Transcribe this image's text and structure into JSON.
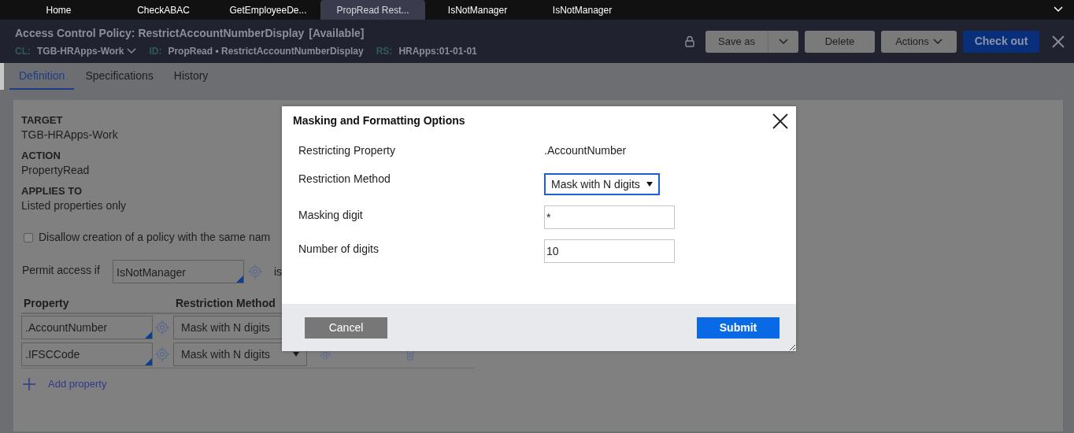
{
  "tabs": [
    {
      "label": "Home",
      "selected": false
    },
    {
      "label": "CheckABAC",
      "selected": false
    },
    {
      "label": "GetEmployeeDe...",
      "selected": false
    },
    {
      "label": "PropRead Rest...",
      "selected": true
    },
    {
      "label": "IsNotManager",
      "selected": false
    },
    {
      "label": "IsNotManager",
      "selected": false
    }
  ],
  "header": {
    "title": "Access Control Policy: RestrictAccountNumberDisplay",
    "status": "[Available]",
    "meta": [
      {
        "key": "CL:",
        "value": "TGB-HRApps-Work",
        "kind": "dropdown"
      },
      {
        "key": "ID:",
        "value": "PropRead • RestrictAccountNumberDisplay",
        "kind": "plain"
      },
      {
        "key": "RS:",
        "value": "HRApps:01-01-01",
        "kind": "plain"
      }
    ]
  },
  "actions": [
    {
      "label": "Save as",
      "kind": "split"
    },
    {
      "label": "Delete",
      "kind": "plain"
    },
    {
      "label": "Actions",
      "kind": "menu"
    },
    {
      "label": "Check out",
      "kind": "primary"
    }
  ],
  "rule_tabs": [
    {
      "label": "Definition",
      "selected": true
    },
    {
      "label": "Specifications",
      "selected": false
    },
    {
      "label": "History",
      "selected": false
    }
  ],
  "fields": [
    {
      "label": "TARGET",
      "value": "TGB-HRApps-Work"
    },
    {
      "label": "ACTION",
      "value": "PropertyRead"
    },
    {
      "label": "APPLIES TO",
      "value": "Listed properties only"
    }
  ],
  "disallow": {
    "label": "Disallow creation of a policy with the same nam",
    "checked": false
  },
  "permit": {
    "label": "Permit access if",
    "value": "IsNotManager",
    "suffix": "is"
  },
  "table": {
    "columns": [
      "Property",
      "Restriction Method"
    ],
    "rows": [
      {
        "property": ".AccountNumber",
        "method": "Mask with N digits",
        "kind": "covered"
      },
      {
        "property": ".IFSCCode",
        "method": "Mask with N digits",
        "kind": "full"
      }
    ]
  },
  "add_property": "Add property",
  "dialog": {
    "title": "Masking and Formatting Options",
    "rows": [
      {
        "label": "Restricting Property",
        "value": ".AccountNumber",
        "kind": "text"
      },
      {
        "label": "Restriction Method",
        "value": "Mask with N digits",
        "kind": "select"
      },
      {
        "label": "Masking digit",
        "value": "*",
        "kind": "input"
      },
      {
        "label": "Number of digits",
        "value": "10",
        "kind": "input"
      }
    ],
    "cancel": "Cancel",
    "submit": "Submit"
  }
}
